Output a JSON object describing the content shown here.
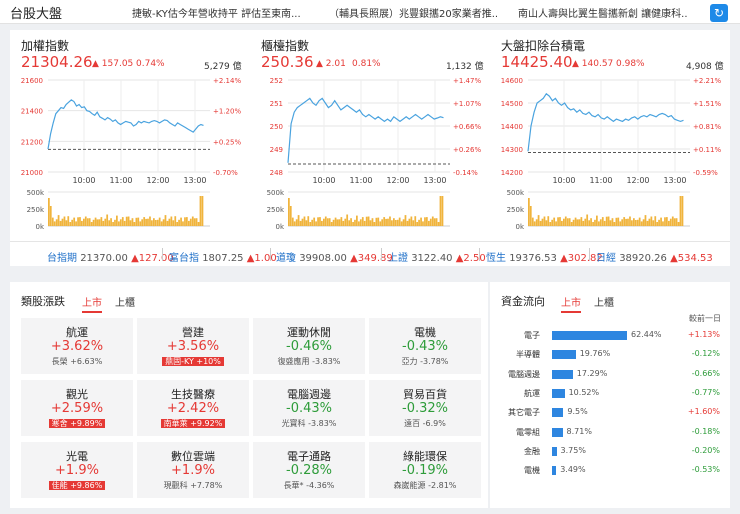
{
  "header": {
    "title": "台股大盤",
    "news": [
      "捷敏-KY估今年營收持平 評估至東南...",
      "（輔具長照展）兆豐銀攜20家業者推...",
      "南山人壽與比翼生醫攜新創 讓健康科..."
    ]
  },
  "indices": [
    {
      "name": "加權指數",
      "value": "21304.26",
      "change": "▲ 157.05",
      "pct": "0.74%",
      "volume": "5,279 億",
      "y_ticks": [
        "21600",
        "21400",
        "21200",
        "21000"
      ],
      "pct_ticks": [
        "+2.14%",
        "+1.20%",
        "+0.25%",
        "-0.70%"
      ],
      "x_ticks": [
        "10:00",
        "11:00",
        "12:00",
        "13:00"
      ],
      "vol_ticks": [
        "500k",
        "250k",
        "0k"
      ],
      "ylim": [
        21000,
        21600
      ],
      "prev_close": 21147.21,
      "series": [
        21150,
        21250,
        21320,
        21380,
        21400,
        21420,
        21415,
        21440,
        21455,
        21470,
        21460,
        21430,
        21440,
        21420,
        21425,
        21400,
        21395,
        21380,
        21370,
        21390,
        21360,
        21350,
        21340,
        21355,
        21345,
        21330,
        21340,
        21320,
        21310,
        21320,
        21330,
        21325,
        21320,
        21300,
        21310,
        21330,
        21320,
        21330,
        21325,
        21320,
        21330,
        21335,
        21330,
        21320,
        21330,
        21340,
        21335,
        21320,
        21310,
        21300,
        21320,
        21310,
        21300,
        21290,
        21280,
        21270,
        21260,
        21280,
        21300,
        21310,
        21304
      ]
    },
    {
      "name": "櫃檯指數",
      "value": "250.36",
      "change": "▲ 2.01",
      "pct": "0.81%",
      "volume": "1,132 億",
      "y_ticks": [
        "252",
        "251",
        "250",
        "249",
        "248"
      ],
      "pct_ticks": [
        "+1.47%",
        "+1.07%",
        "+0.66%",
        "+0.26%",
        "-0.14%"
      ],
      "x_ticks": [
        "10:00",
        "11:00",
        "12:00",
        "13:00"
      ],
      "vol_ticks": [
        "500k",
        "250k",
        "0k"
      ],
      "ylim": [
        248,
        252
      ],
      "prev_close": 248.35,
      "series": [
        248.4,
        250.1,
        250.6,
        250.8,
        250.9,
        251.0,
        251.1,
        251.2,
        251.0,
        250.9,
        251.1,
        251.2,
        251.0,
        250.8,
        250.9,
        251.1,
        250.9,
        250.7,
        250.8,
        250.9,
        250.8,
        250.7,
        250.6,
        250.7,
        250.5,
        250.4,
        250.5,
        250.4,
        250.3,
        250.4,
        250.3,
        250.2,
        250.3,
        250.2,
        250.4,
        250.3,
        250.2,
        250.3,
        250.4,
        250.3,
        250.4,
        250.5,
        250.4,
        250.3,
        250.4,
        250.5,
        250.4,
        250.3,
        250.35,
        250.4,
        250.36
      ]
    },
    {
      "name": "大盤扣除台積電",
      "value": "14425.40",
      "change": "▲ 140.57",
      "pct": "0.98%",
      "volume": "4,908 億",
      "y_ticks": [
        "14600",
        "14500",
        "14400",
        "14300",
        "14200"
      ],
      "pct_ticks": [
        "+2.21%",
        "+1.51%",
        "+0.81%",
        "+0.11%",
        "-0.59%"
      ],
      "x_ticks": [
        "10:00",
        "11:00",
        "12:00",
        "13:00"
      ],
      "vol_ticks": [
        "500k",
        "250k",
        "0k"
      ],
      "ylim": [
        14200,
        14600
      ],
      "prev_close": 14284.83,
      "series": [
        14290,
        14400,
        14460,
        14500,
        14510,
        14520,
        14540,
        14530,
        14510,
        14520,
        14500,
        14490,
        14500,
        14480,
        14470,
        14475,
        14460,
        14470,
        14455,
        14450,
        14460,
        14445,
        14440,
        14450,
        14435,
        14430,
        14440,
        14430,
        14420,
        14430,
        14425,
        14420,
        14430,
        14425,
        14435,
        14440,
        14430,
        14440,
        14445,
        14440,
        14450,
        14445,
        14440,
        14450,
        14455,
        14450,
        14440,
        14445,
        14430,
        14425,
        14420,
        14425
      ]
    }
  ],
  "tickers": [
    {
      "name": "台指期",
      "value": "21370.00",
      "change": "▲127.00"
    },
    {
      "name": "富台指",
      "value": "1807.25",
      "change": "▲1.00"
    },
    {
      "name": "道瓊",
      "value": "39908.00",
      "change": "▲349.89"
    },
    {
      "name": "上證",
      "value": "3122.40",
      "change": "▲2.50"
    },
    {
      "name": "恆生",
      "value": "19376.53",
      "change": "▲302.82"
    },
    {
      "name": "日經",
      "value": "38920.26",
      "change": "▲534.53"
    }
  ],
  "sectors": {
    "title": "類股漲跌",
    "tabs": [
      "上市",
      "上櫃"
    ],
    "cells": [
      {
        "name": "航運",
        "pct": "+3.62%",
        "dir": "up",
        "stock": "長榮",
        "stock_pct": "+6.63%",
        "tag": false
      },
      {
        "name": "營建",
        "pct": "+3.56%",
        "dir": "up",
        "stock": "鼎固-KY",
        "stock_pct": "+10%",
        "tag": true
      },
      {
        "name": "運動休閒",
        "pct": "-0.46%",
        "dir": "down",
        "stock": "復盛應用",
        "stock_pct": "-3.83%",
        "tag": false
      },
      {
        "name": "電機",
        "pct": "-0.43%",
        "dir": "down",
        "stock": "亞力",
        "stock_pct": "-3.78%",
        "tag": false
      },
      {
        "name": "觀光",
        "pct": "+2.59%",
        "dir": "up",
        "stock": "寒舍",
        "stock_pct": "+9.89%",
        "tag": true
      },
      {
        "name": "生技醫療",
        "pct": "+2.42%",
        "dir": "up",
        "stock": "南華萊",
        "stock_pct": "+9.92%",
        "tag": true
      },
      {
        "name": "電腦週邊",
        "pct": "-0.43%",
        "dir": "down",
        "stock": "光寶科",
        "stock_pct": "-3.83%",
        "tag": false
      },
      {
        "name": "貿易百貨",
        "pct": "-0.32%",
        "dir": "down",
        "stock": "遠百",
        "stock_pct": "-6.9%",
        "tag": false
      },
      {
        "name": "光電",
        "pct": "+1.9%",
        "dir": "up",
        "stock": "佳能",
        "stock_pct": "+9.86%",
        "tag": true
      },
      {
        "name": "數位雲端",
        "pct": "+1.9%",
        "dir": "up",
        "stock": "現觀科",
        "stock_pct": "+7.78%",
        "tag": false
      },
      {
        "name": "電子通路",
        "pct": "-0.28%",
        "dir": "down",
        "stock": "長華*",
        "stock_pct": "-4.36%",
        "tag": false
      },
      {
        "name": "綠能環保",
        "pct": "-0.19%",
        "dir": "down",
        "stock": "森崴能源",
        "stock_pct": "-2.81%",
        "tag": false
      }
    ]
  },
  "fund_flow": {
    "title": "資金流向",
    "tabs": [
      "上市",
      "上櫃"
    ],
    "compare_label": "較前一日",
    "rows": [
      {
        "label": "電子",
        "share": 62.44,
        "share_text": "62.44%",
        "change": "+1.13%",
        "dir": "up"
      },
      {
        "label": "半導體",
        "share": 19.76,
        "share_text": "19.76%",
        "change": "-0.12%",
        "dir": "down"
      },
      {
        "label": "電腦週邊",
        "share": 17.29,
        "share_text": "17.29%",
        "change": "-0.66%",
        "dir": "down"
      },
      {
        "label": "航運",
        "share": 10.52,
        "share_text": "10.52%",
        "change": "-0.77%",
        "dir": "down"
      },
      {
        "label": "其它電子",
        "share": 9.5,
        "share_text": "9.5%",
        "change": "+1.60%",
        "dir": "up"
      },
      {
        "label": "電零組",
        "share": 8.71,
        "share_text": "8.71%",
        "change": "-0.18%",
        "dir": "down"
      },
      {
        "label": "金融",
        "share": 3.75,
        "share_text": "3.75%",
        "change": "-0.20%",
        "dir": "down"
      },
      {
        "label": "電機",
        "share": 3.49,
        "share_text": "3.49%",
        "change": "-0.53%",
        "dir": "down"
      }
    ]
  },
  "colors": {
    "up": "#e53935",
    "down": "#2e9c3a",
    "line": "#4aa3df",
    "bar": "#2e86e0",
    "volume": "#f0b43c",
    "accent": "#1e8ae8"
  }
}
